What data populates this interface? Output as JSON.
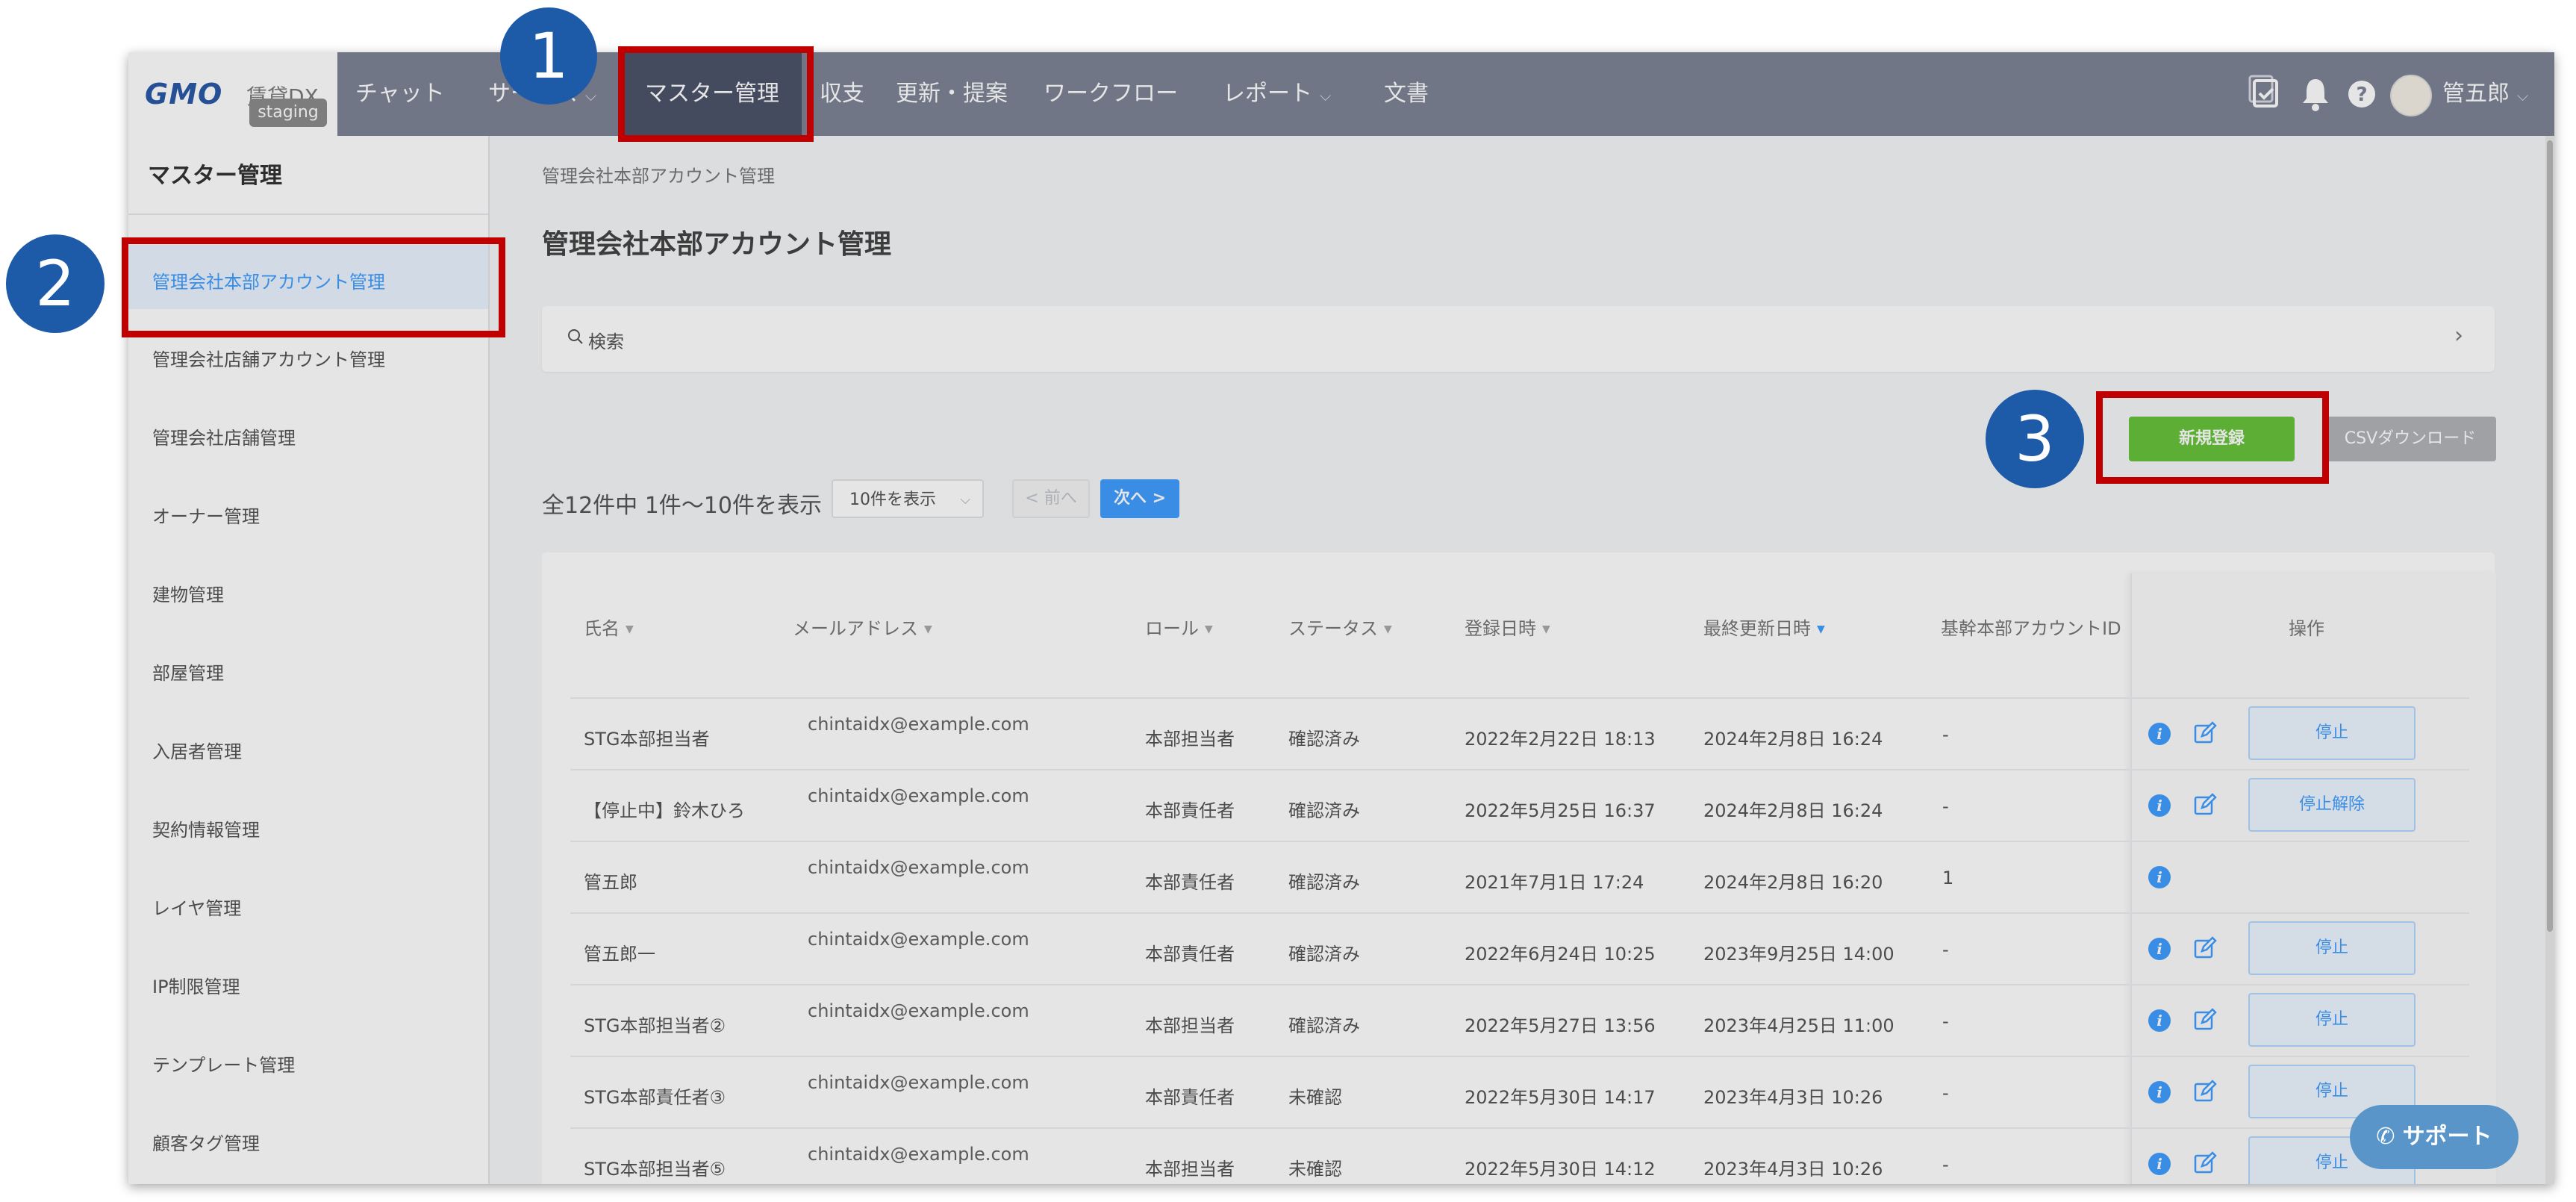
{
  "header": {
    "logo_text": "GMO",
    "logo_sub": "賃貸DX",
    "env_badge": "staging",
    "nav": [
      {
        "label": "チャット",
        "has_chevron": false
      },
      {
        "label": "サービス",
        "has_chevron": true
      },
      {
        "label": "マスター管理",
        "has_chevron": false,
        "active": true
      },
      {
        "label": "収支",
        "has_chevron": false
      },
      {
        "label": "更新・提案",
        "has_chevron": false
      },
      {
        "label": "ワークフロー",
        "has_chevron": false
      },
      {
        "label": "レポート",
        "has_chevron": true
      },
      {
        "label": "文書",
        "has_chevron": false
      }
    ],
    "user_name": "管五郎"
  },
  "sidebar": {
    "title": "マスター管理",
    "items": [
      {
        "label": "管理会社本部アカウント管理",
        "active": true
      },
      {
        "label": "管理会社店舗アカウント管理"
      },
      {
        "label": "管理会社店舗管理"
      },
      {
        "label": "オーナー管理"
      },
      {
        "label": "建物管理"
      },
      {
        "label": "部屋管理"
      },
      {
        "label": "入居者管理"
      },
      {
        "label": "契約情報管理"
      },
      {
        "label": "レイヤ管理"
      },
      {
        "label": "IP制限管理"
      },
      {
        "label": "テンプレート管理"
      },
      {
        "label": "顧客タグ管理"
      }
    ]
  },
  "main": {
    "breadcrumb": "管理会社本部アカウント管理",
    "title": "管理会社本部アカウント管理",
    "search_label": "検索",
    "new_button": "新規登録",
    "csv_button": "CSVダウンロード",
    "count_text": "全12件中 1件〜10件を表示",
    "per_page": "10件を表示",
    "prev_label": "< 前へ",
    "next_label": "次へ >"
  },
  "table": {
    "headers": [
      "氏名",
      "メールアドレス",
      "ロール",
      "ステータス",
      "登録日時",
      "最終更新日時",
      "基幹本部アカウントID",
      "操作"
    ],
    "rows": [
      {
        "name": "STG本部担当者",
        "email": "chintaidx@example.com",
        "role": "本部担当者",
        "status": "確認済み",
        "created": "2022年2月22日 18:13",
        "updated": "2024年2月8日 16:24",
        "core_id": "-",
        "action": "停止",
        "editable": true
      },
      {
        "name": "【停止中】鈴木ひろ",
        "email": "chintaidx@example.com",
        "role": "本部責任者",
        "status": "確認済み",
        "created": "2022年5月25日 16:37",
        "updated": "2024年2月8日 16:24",
        "core_id": "-",
        "action": "停止解除",
        "editable": true
      },
      {
        "name": "管五郎",
        "email": "chintaidx@example.com",
        "role": "本部責任者",
        "status": "確認済み",
        "created": "2021年7月1日 17:24",
        "updated": "2024年2月8日 16:20",
        "core_id": "1",
        "action": "",
        "editable": false
      },
      {
        "name": "管五郎一",
        "email": "chintaidx@example.com",
        "role": "本部責任者",
        "status": "確認済み",
        "created": "2022年6月24日 10:25",
        "updated": "2023年9月25日 14:00",
        "core_id": "-",
        "action": "停止",
        "editable": true
      },
      {
        "name": "STG本部担当者②",
        "email": "chintaidx@example.com",
        "role": "本部担当者",
        "status": "確認済み",
        "created": "2022年5月27日 13:56",
        "updated": "2023年4月25日 11:00",
        "core_id": "-",
        "action": "停止",
        "editable": true
      },
      {
        "name": "STG本部責任者③",
        "email": "chintaidx@example.com",
        "role": "本部責任者",
        "status": "未確認",
        "created": "2022年5月30日 14:17",
        "updated": "2023年4月3日 10:26",
        "core_id": "-",
        "action": "停止",
        "editable": true
      },
      {
        "name": "STG本部担当者⑤",
        "email": "chintaidx@example.com",
        "role": "本部担当者",
        "status": "未確認",
        "created": "2022年5月30日 14:12",
        "updated": "2023年4月3日 10:26",
        "core_id": "-",
        "action": "停止",
        "editable": true
      }
    ]
  },
  "support_label": "サポート",
  "annotations": [
    "1",
    "2",
    "3"
  ],
  "colors": {
    "nav_bg": "#7d8496",
    "nav_active": "#4d546a",
    "primary": "#409eff",
    "success": "#67c23a",
    "highlight": "#c00000",
    "badge": "#1d5aa8"
  }
}
